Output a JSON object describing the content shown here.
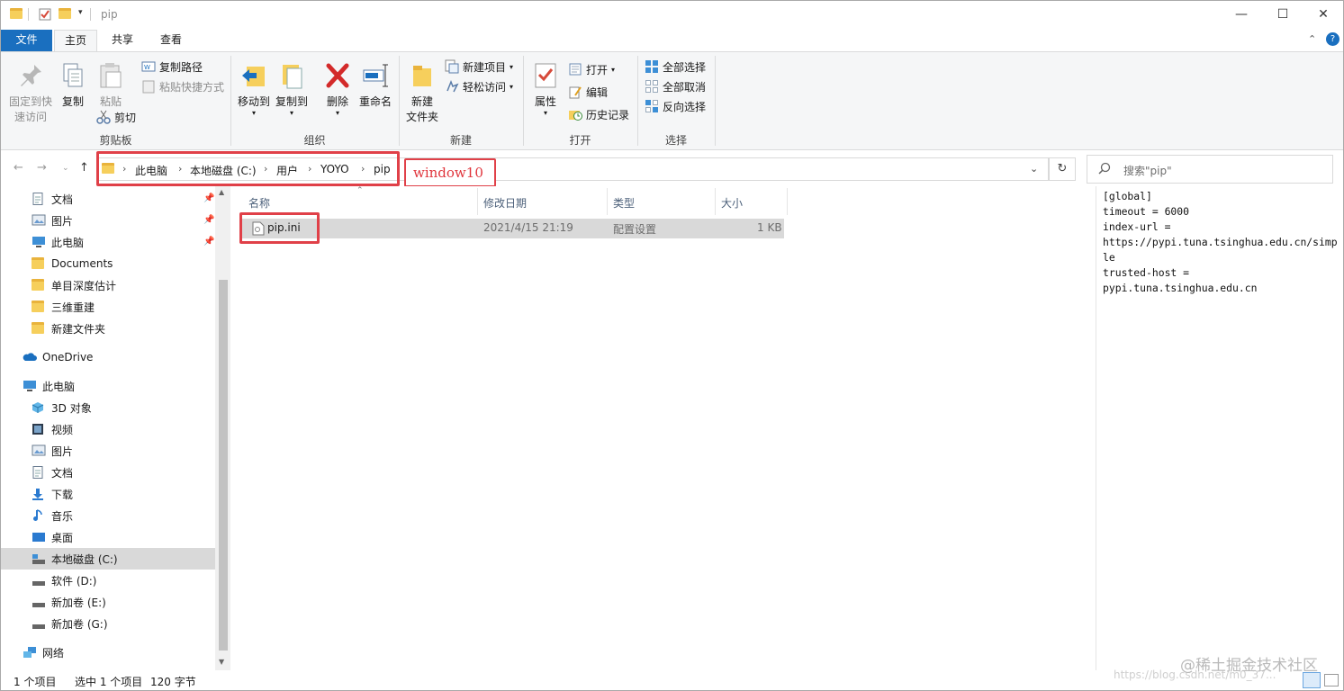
{
  "window": {
    "title": "pip"
  },
  "tabs": [
    "文件",
    "主页",
    "共享",
    "查看"
  ],
  "ribbon": {
    "clipboard": {
      "pin": "固定到快速访问",
      "pin_l1": "固定到快",
      "pin_l2": "速访问",
      "copy": "复制",
      "paste": "粘贴",
      "copy_path": "复制路径",
      "paste_shortcut": "粘贴快捷方式",
      "cut": "剪切",
      "label": "剪贴板"
    },
    "organize": {
      "move_to": "移动到",
      "copy_to": "复制到",
      "delete": "删除",
      "rename": "重命名",
      "label": "组织"
    },
    "new": {
      "new_folder_l1": "新建",
      "new_folder_l2": "文件夹",
      "new_item": "新建项目",
      "easy_access": "轻松访问",
      "label": "新建"
    },
    "open": {
      "properties": "属性",
      "open": "打开",
      "edit": "编辑",
      "history": "历史记录",
      "label": "打开"
    },
    "select": {
      "select_all": "全部选择",
      "select_none": "全部取消",
      "invert": "反向选择",
      "label": "选择"
    }
  },
  "address": {
    "crumbs": [
      "此电脑",
      "本地磁盘 (C:)",
      "用户",
      "YOYO",
      "pip"
    ],
    "annotation": "window10"
  },
  "search": {
    "placeholder": "搜索\"pip\""
  },
  "nav": {
    "quick": [
      {
        "label": "文档",
        "icon": "document-icon",
        "pinned": true
      },
      {
        "label": "图片",
        "icon": "pictures-icon",
        "pinned": true
      },
      {
        "label": "此电脑",
        "icon": "computer-icon",
        "pinned": true
      },
      {
        "label": "Documents",
        "icon": "folder-icon",
        "pinned": false
      },
      {
        "label": "单目深度估计",
        "icon": "folder-icon",
        "pinned": false
      },
      {
        "label": "三维重建",
        "icon": "folder-icon",
        "pinned": false
      },
      {
        "label": "新建文件夹",
        "icon": "folder-icon",
        "pinned": false
      }
    ],
    "onedrive": "OneDrive",
    "thispc": "此电脑",
    "pc_items": [
      "3D 对象",
      "视频",
      "图片",
      "文档",
      "下载",
      "音乐",
      "桌面",
      "本地磁盘 (C:)",
      "软件 (D:)",
      "新加卷 (E:)",
      "新加卷 (G:)"
    ],
    "network": "网络"
  },
  "columns": {
    "name": "名称",
    "modified": "修改日期",
    "type": "类型",
    "size": "大小"
  },
  "files": [
    {
      "name": "pip.ini",
      "modified": "2021/4/15 21:19",
      "type": "配置设置",
      "size": "1 KB"
    }
  ],
  "preview": {
    "content": "[global]\ntimeout = 6000\nindex-url =\nhttps://pypi.tuna.tsinghua.edu.cn/simple\ntrusted-host =\npypi.tuna.tsinghua.edu.cn"
  },
  "status": {
    "count": "1 个项目",
    "selected": "选中 1 个项目",
    "size": "120 字节"
  },
  "watermark": {
    "main": "@稀土掘金技术社区",
    "sub": "https://blog.csdn.net/m0_37..."
  },
  "colors": {
    "accent": "#1a6fbf",
    "highlight": "#e04048",
    "folder": "#f6cf5c"
  }
}
